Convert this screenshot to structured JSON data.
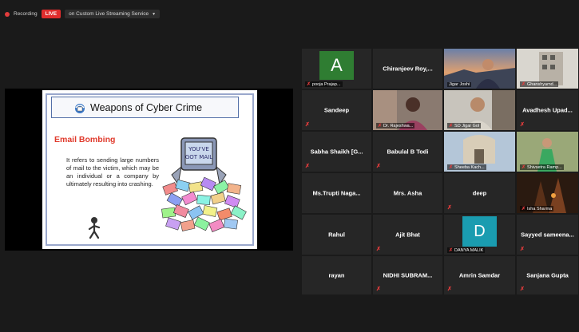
{
  "topbar": {
    "recording_label": "Recording",
    "live_label": "LIVE",
    "stream_label": "on Custom Live Streaming Service"
  },
  "slide": {
    "title": "Weapons of Cyber Crime",
    "subtitle": "Email Bombing",
    "body": "It refers to sending large numbers of mail to the victim, which may be an individual or a company by ultimately resulting into crashing.",
    "cartoon_text": "YOU'VE GOT MAIL"
  },
  "gallery": {
    "tiles": [
      {
        "id": "pooja",
        "label": "pooja Prajap...",
        "avatar_letter": "A",
        "avatar_color": "#2f7d32"
      },
      {
        "id": "chiranjeev",
        "name": "Chiranjeev Roy,..."
      },
      {
        "id": "jigar",
        "label": "Jigar Joshi"
      },
      {
        "id": "ghanshyam",
        "label": "Ghanshyamd..."
      },
      {
        "id": "sandeep",
        "name": "Sandeep"
      },
      {
        "id": "rajeshwari",
        "label": "Dr. Rajeshwa..."
      },
      {
        "id": "jigargol",
        "label": "SD Jigar Gol"
      },
      {
        "id": "avadhesh",
        "name": "Avadhesh Upad..."
      },
      {
        "id": "sabha",
        "name": "Sabha Shaikh [G..."
      },
      {
        "id": "babulal",
        "name": "Babulal B Todi"
      },
      {
        "id": "sheeba",
        "label": "Sheeba Kach..."
      },
      {
        "id": "shivsetra",
        "label": "Shivsetra Ramp..."
      },
      {
        "id": "trupti",
        "name": "Ms.Trupti Naga..."
      },
      {
        "id": "asha",
        "name": "Mrs. Asha"
      },
      {
        "id": "deep",
        "name": "deep"
      },
      {
        "id": "isha",
        "label": "Isha Sharma"
      },
      {
        "id": "rahul",
        "name": "Rahul"
      },
      {
        "id": "ajit",
        "name": "Ajit Bhat"
      },
      {
        "id": "danya",
        "label": "DANYA MALIK",
        "avatar_letter": "D",
        "avatar_color": "#1a9cb0"
      },
      {
        "id": "sayyed",
        "name": "Sayyed sameena..."
      },
      {
        "id": "rayan",
        "name": "rayan"
      },
      {
        "id": "nidhi",
        "name": "NIDHI SUBRAM..."
      },
      {
        "id": "amrin",
        "name": "Amrin Samdar"
      },
      {
        "id": "sanjana",
        "name": "Sanjana Gupta"
      }
    ]
  },
  "colors": {
    "live": "#e02d2d",
    "muted": "#e23c3c",
    "active_border": "#b6d23a",
    "slide_title_border": "#5470a8",
    "subtitle": "#e03a2c"
  }
}
